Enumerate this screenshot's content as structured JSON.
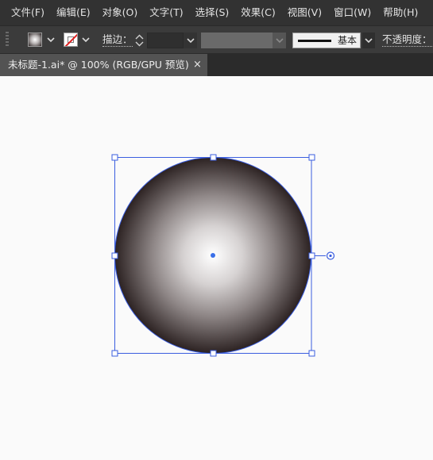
{
  "menu": {
    "items": [
      "文件(F)",
      "编辑(E)",
      "对象(O)",
      "文字(T)",
      "选择(S)",
      "效果(C)",
      "视图(V)",
      "窗口(W)",
      "帮助(H)"
    ],
    "workspace_icon": "workspace-grid-icon"
  },
  "control": {
    "fill_label": "",
    "stroke_label": "描边：",
    "brush_name": "基本",
    "opacity_label": "不透明度："
  },
  "tab": {
    "title": "未标题-1.ai* @ 100% (RGB/GPU 预览)",
    "close": "×"
  },
  "artboard": {
    "object": "ellipse",
    "fill": "radial-gradient",
    "gradient_stops": [
      "#ffffff",
      "#8e8686",
      "#2c2222"
    ],
    "selection_color": "#3a5ddf"
  }
}
